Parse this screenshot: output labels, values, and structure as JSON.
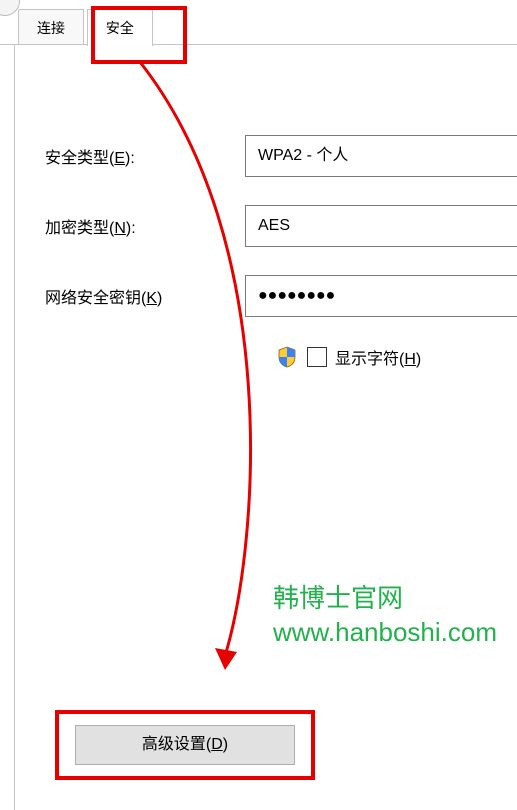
{
  "tabs": {
    "connect": "连接",
    "security": "安全"
  },
  "fields": {
    "securityType": {
      "label": "安全类型(",
      "hotkey": "E",
      "labelEnd": "):",
      "value": "WPA2 - 个人"
    },
    "encryption": {
      "label": "加密类型(",
      "hotkey": "N",
      "labelEnd": "):",
      "value": "AES"
    },
    "key": {
      "label": "网络安全密钥(",
      "hotkey": "K",
      "labelEnd": ")",
      "value": "●●●●●●●●"
    }
  },
  "showChars": {
    "label": "显示字符(",
    "hotkey": "H",
    "labelEnd": ")"
  },
  "advanced": {
    "label": "高级设置(",
    "hotkey": "D",
    "labelEnd": ")"
  },
  "watermark": {
    "line1": "韩博士官网",
    "line2": "www.hanboshi.com"
  },
  "colors": {
    "highlight": "#e60000",
    "watermark": "#22b14c"
  }
}
